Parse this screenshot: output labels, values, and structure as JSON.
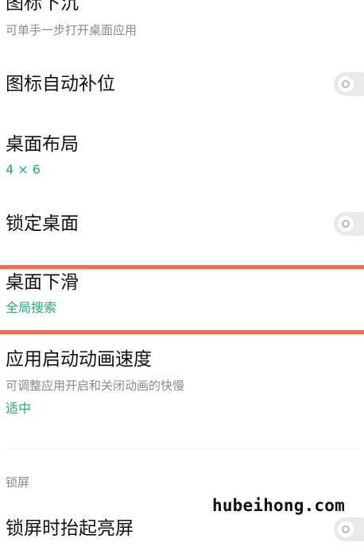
{
  "colors": {
    "accent_green": "#1fae73",
    "highlight": "#e8714c",
    "toggle_off": "#e9e9e9"
  },
  "settings": [
    {
      "title": "图标下沉",
      "subtitle": "可单手一步打开桌面应用"
    },
    {
      "title": "图标自动补位",
      "toggle": "off"
    },
    {
      "title": "桌面布局",
      "value": "4 × 6"
    },
    {
      "title": "锁定桌面",
      "toggle": "off"
    },
    {
      "title": "桌面下滑",
      "value": "全局搜索"
    },
    {
      "title": "应用启动动画速度",
      "subtitle": "可调整应用开启和关闭动画的快慢",
      "value": "适中"
    }
  ],
  "lockscreen": {
    "header": "锁屏",
    "partial_item_title": "锁屏时抬起亮屏"
  },
  "watermark": "hubeihong.com"
}
